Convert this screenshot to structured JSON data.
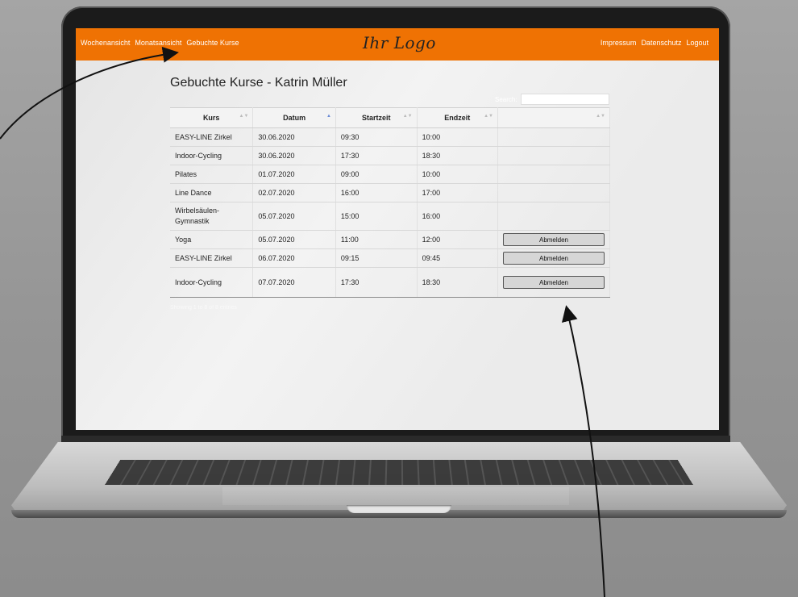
{
  "nav": {
    "left": [
      "Wochenansicht",
      "Monatsansicht",
      "Gebuchte Kurse"
    ],
    "right": [
      "Impressum",
      "Datenschutz",
      "Logout"
    ],
    "logo": "Ihr Logo"
  },
  "page": {
    "title": "Gebuchte Kurse - Katrin Müller",
    "search_label": "Search:",
    "search_value": "",
    "footer_text": "Showing 1 to 8 of 8 entries"
  },
  "table": {
    "headers": [
      "Kurs",
      "Datum",
      "Startzeit",
      "Endzeit",
      ""
    ],
    "sorted_column": "Datum",
    "button_label": "Abmelden",
    "rows": [
      {
        "kurs": "EASY-LINE Zirkel",
        "datum": "30.06.2020",
        "start": "09:30",
        "end": "10:00",
        "action": ""
      },
      {
        "kurs": "Indoor-Cycling",
        "datum": "30.06.2020",
        "start": "17:30",
        "end": "18:30",
        "action": ""
      },
      {
        "kurs": "Pilates",
        "datum": "01.07.2020",
        "start": "09:00",
        "end": "10:00",
        "action": ""
      },
      {
        "kurs": "Line Dance",
        "datum": "02.07.2020",
        "start": "16:00",
        "end": "17:00",
        "action": ""
      },
      {
        "kurs": "Wirbelsäulen-Gymnastik",
        "datum": "05.07.2020",
        "start": "15:00",
        "end": "16:00",
        "action": ""
      },
      {
        "kurs": "Yoga",
        "datum": "05.07.2020",
        "start": "11:00",
        "end": "12:00",
        "action": "Abmelden"
      },
      {
        "kurs": "EASY-LINE Zirkel",
        "datum": "06.07.2020",
        "start": "09:15",
        "end": "09:45",
        "action": "Abmelden"
      },
      {
        "kurs": "Indoor-Cycling",
        "datum": "07.07.2020",
        "start": "17:30",
        "end": "18:30",
        "action": "Abmelden"
      }
    ]
  },
  "colors": {
    "topbar": "#ef7203",
    "screen_bg": "#f3f3f3",
    "button_bg": "#d6d6d6"
  }
}
